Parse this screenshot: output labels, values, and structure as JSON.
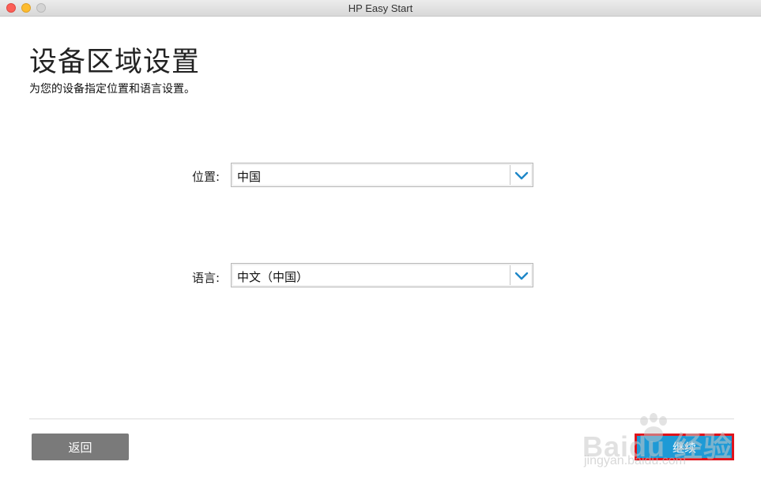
{
  "window": {
    "title": "HP Easy Start"
  },
  "page": {
    "title": "设备区域设置",
    "subtitle": "为您的设备指定位置和语言设置。"
  },
  "form": {
    "location": {
      "label": "位置:",
      "value": "中国"
    },
    "language": {
      "label": "语言:",
      "value": "中文（中国）"
    }
  },
  "footer": {
    "back_label": "返回",
    "continue_label": "继续"
  },
  "watermark": {
    "brand": "Baidu 经验",
    "url": "jingyan.baidu.com"
  },
  "colors": {
    "accent": "#1e9ad6",
    "back_button": "#7a7a7a",
    "highlight": "#e0141c",
    "chevron": "#1e87c8"
  }
}
